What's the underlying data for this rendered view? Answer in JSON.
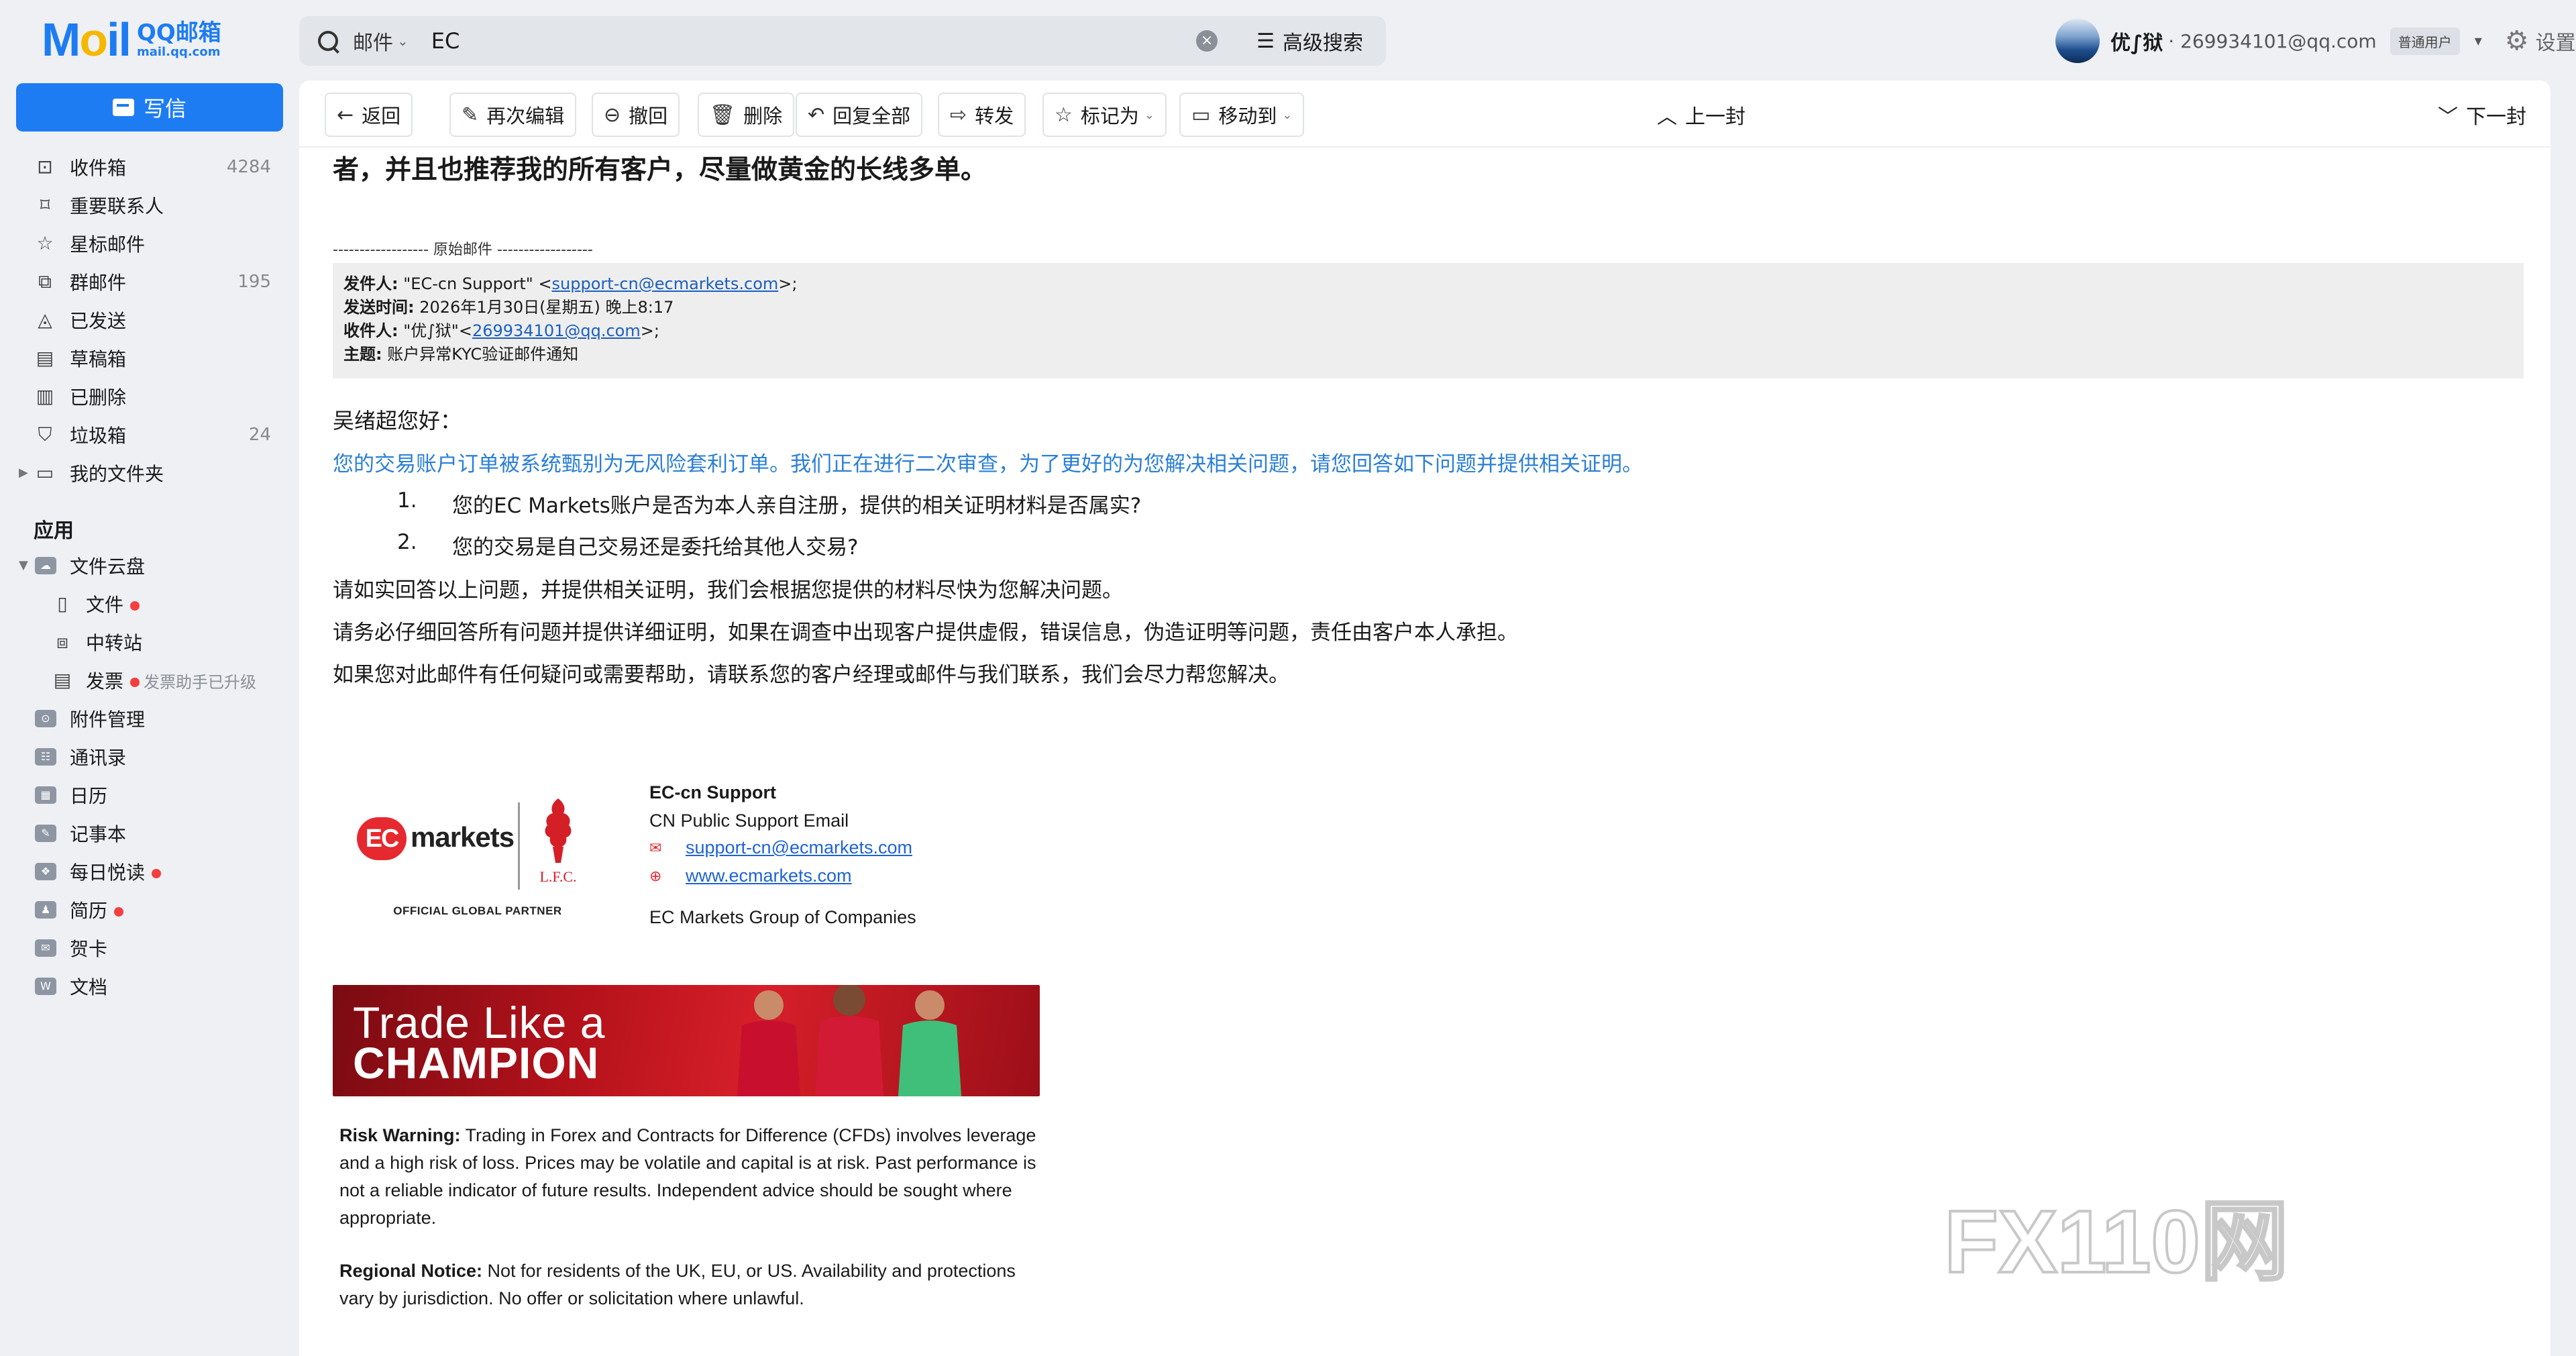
{
  "app": {
    "logo_text": "Mail",
    "logo_cn": "QQ邮箱",
    "logo_domain": "mail.qq.com",
    "accent_color": "#1e7cf2"
  },
  "search": {
    "scope": "邮件",
    "query": "EC",
    "advanced_label": "高级搜索"
  },
  "user": {
    "name": "优∫狱",
    "email": "· 269934101@qq.com",
    "type_badge": "普通用户",
    "settings_label": "设置"
  },
  "sidebar": {
    "compose_label": "写信",
    "folders": [
      {
        "label": "收件箱",
        "count": "4284",
        "icon": "inbox-icon"
      },
      {
        "label": "重要联系人",
        "count": "",
        "icon": "bookmark-icon"
      },
      {
        "label": "星标邮件",
        "count": "",
        "icon": "star-icon"
      },
      {
        "label": "群邮件",
        "count": "195",
        "icon": "group-mail-icon"
      },
      {
        "label": "已发送",
        "count": "",
        "icon": "sent-icon"
      },
      {
        "label": "草稿箱",
        "count": "",
        "icon": "draft-icon"
      },
      {
        "label": "已删除",
        "count": "",
        "icon": "trash-icon"
      },
      {
        "label": "垃圾箱",
        "count": "24",
        "icon": "spam-shield-icon"
      },
      {
        "label": "我的文件夹",
        "count": "",
        "icon": "folder-icon"
      }
    ],
    "apps_title": "应用",
    "apps": {
      "cloud_label": "文件云盘",
      "files_label": "文件",
      "transfer_label": "中转站",
      "invoice_label": "发票",
      "invoice_note": "发票助手已升级",
      "attachments_label": "附件管理",
      "contacts_label": "通讯录",
      "calendar_label": "日历",
      "notes_label": "记事本",
      "daily_label": "每日悦读",
      "resume_label": "简历",
      "cards_label": "贺卡",
      "docs_label": "文档"
    }
  },
  "toolbar": {
    "back": "返回",
    "reedit": "再次编辑",
    "recall": "撤回",
    "delete": "删除",
    "reply_all": "回复全部",
    "forward": "转发",
    "mark_as": "标记为",
    "move_to": "移动到",
    "prev": "上一封",
    "next": "下一封"
  },
  "email": {
    "lead_text": "者，并且也推荐我的所有客户，尽量做黄金的长线多单。",
    "orig_separator": "------------------ 原始邮件 ------------------",
    "orig": {
      "from_label": "发件人:",
      "from_name": " \"EC-cn Support\" <",
      "from_email": "support-cn@ecmarkets.com",
      "from_tail": ">;",
      "date_label": "发送时间:",
      "date_value": " 2026年1月30日(星期五) 晚上8:17",
      "to_label": "收件人:",
      "to_name": " \"优∫狱\"<",
      "to_email": "269934101@qq.com",
      "to_tail": ">;",
      "subject_label": "主题:",
      "subject_value": " 账户异常KYC验证邮件通知"
    },
    "greeting": "吴绪超您好：",
    "blue_paragraph": "您的交易账户订单被系统甄别为无风险套利订单。我们正在进行二次审查，为了更好的为您解决相关问题，请您回答如下问题并提供相关证明。",
    "questions": [
      {
        "num": "1.",
        "text": "您的EC Markets账户是否为本人亲自注册，提供的相关证明材料是否属实?"
      },
      {
        "num": "2.",
        "text": "您的交易是自己交易还是委托给其他人交易?"
      }
    ],
    "paragraphs": [
      "请如实回答以上问题，并提供相关证明，我们会根据您提供的材料尽快为您解决问题。",
      "请务必仔细回答所有问题并提供详细证明，如果在调查中出现客户提供虚假，错误信息，伪造证明等问题，责任由客户本人承担。",
      "如果您对此邮件有任何疑问或需要帮助，请联系您的客户经理或邮件与我们联系，我们会尽力帮您解决。"
    ],
    "signature": {
      "logo_badge": "EC",
      "logo_word": "markets",
      "partner_text": "OFFICIAL GLOBAL PARTNER",
      "lfc_text": "L.F.C.",
      "name": "EC-cn Support",
      "title": "CN Public Support Email",
      "email": "support-cn@ecmarkets.com",
      "website": "www.ecmarkets.com",
      "group": "EC Markets Group of Companies",
      "brand_color": "#e6282f"
    },
    "banner": {
      "line1": "Trade Like a",
      "line2": "CHAMPION"
    },
    "risk_label": "Risk Warning:",
    "risk_text": " Trading in Forex and Contracts for Difference (CFDs) involves leverage and a high risk of loss. Prices may be volatile and capital is at risk. Past performance is not a reliable indicator of future results. Independent advice should be sought where appropriate.",
    "regional_label": "Regional Notice:",
    "regional_text": " Not for residents of the UK, EU, or US. Availability and protections vary by jurisdiction. No offer or solicitation where unlawful."
  },
  "watermark": {
    "text": "FX110网"
  }
}
